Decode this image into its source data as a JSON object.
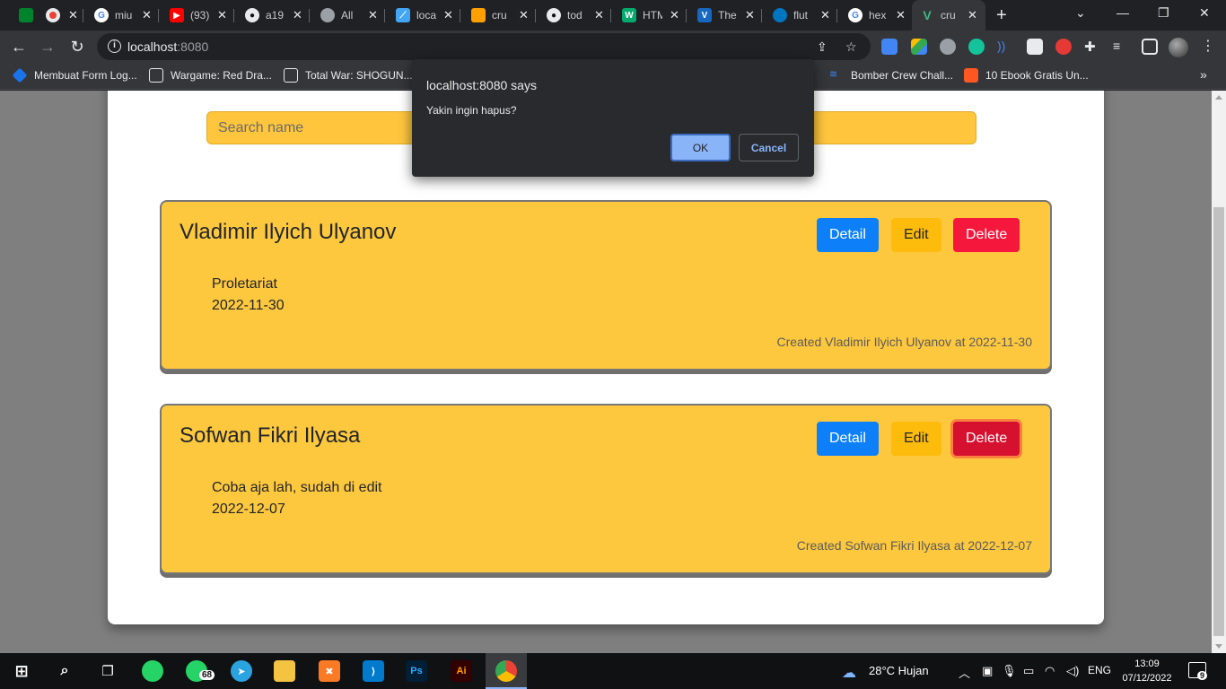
{
  "browser": {
    "tabs": [
      {
        "title": "",
        "icon": "meet-icon"
      },
      {
        "title": "",
        "icon": "record-icon"
      },
      {
        "title": "miu",
        "icon": "google-icon"
      },
      {
        "title": "(93)",
        "icon": "youtube-icon"
      },
      {
        "title": "a19",
        "icon": "github-icon"
      },
      {
        "title": "All",
        "icon": "globe-icon"
      },
      {
        "title": "loca",
        "icon": "flutter-icon"
      },
      {
        "title": "cru",
        "icon": "firebase-icon"
      },
      {
        "title": "tod",
        "icon": "github-icon"
      },
      {
        "title": "HTM",
        "icon": "w3-icon"
      },
      {
        "title": "The",
        "icon": "vuetify-icon"
      },
      {
        "title": "flut",
        "icon": "dart-icon"
      },
      {
        "title": "hex",
        "icon": "google-icon"
      },
      {
        "title": "cru",
        "icon": "vue-icon"
      }
    ],
    "url_host": "localhost",
    "url_port": ":8080",
    "bookmarks": [
      "Membuat Form Log...",
      "Wargame: Red Dra...",
      "Total War: SHOGUN...",
      "Bomber Crew Chall...",
      "10 Ebook Gratis Un..."
    ]
  },
  "page": {
    "search_placeholder": "Search name",
    "button_labels": {
      "detail": "Detail",
      "edit": "Edit",
      "delete": "Delete"
    },
    "cards": [
      {
        "name": "Vladimir Ilyich Ulyanov",
        "description": "Proletariat",
        "date": "2022-11-30",
        "footer": "Created Vladimir Ilyich Ulyanov at 2022-11-30"
      },
      {
        "name": "Sofwan Fikri Ilyasa",
        "description": "Coba aja lah, sudah di edit",
        "date": "2022-12-07",
        "footer": "Created Sofwan Fikri Ilyasa at 2022-12-07"
      }
    ]
  },
  "dialog": {
    "title": "localhost:8080 says",
    "message": "Yakin ingin hapus?",
    "ok_label": "OK",
    "cancel_label": "Cancel"
  },
  "taskbar": {
    "whatsapp_badge": "68",
    "weather": "28°C  Hujan",
    "language": "ENG",
    "time": "13:09",
    "date": "07/12/2022",
    "notification_count": "9"
  },
  "colors": {
    "card_bg": "#fec83e",
    "detail_btn": "#0d7ff8",
    "edit_btn": "#fdbb0c",
    "delete_btn": "#f5173c",
    "dialog_bg": "#292a2d",
    "dialog_ok": "#8ab4f8"
  }
}
